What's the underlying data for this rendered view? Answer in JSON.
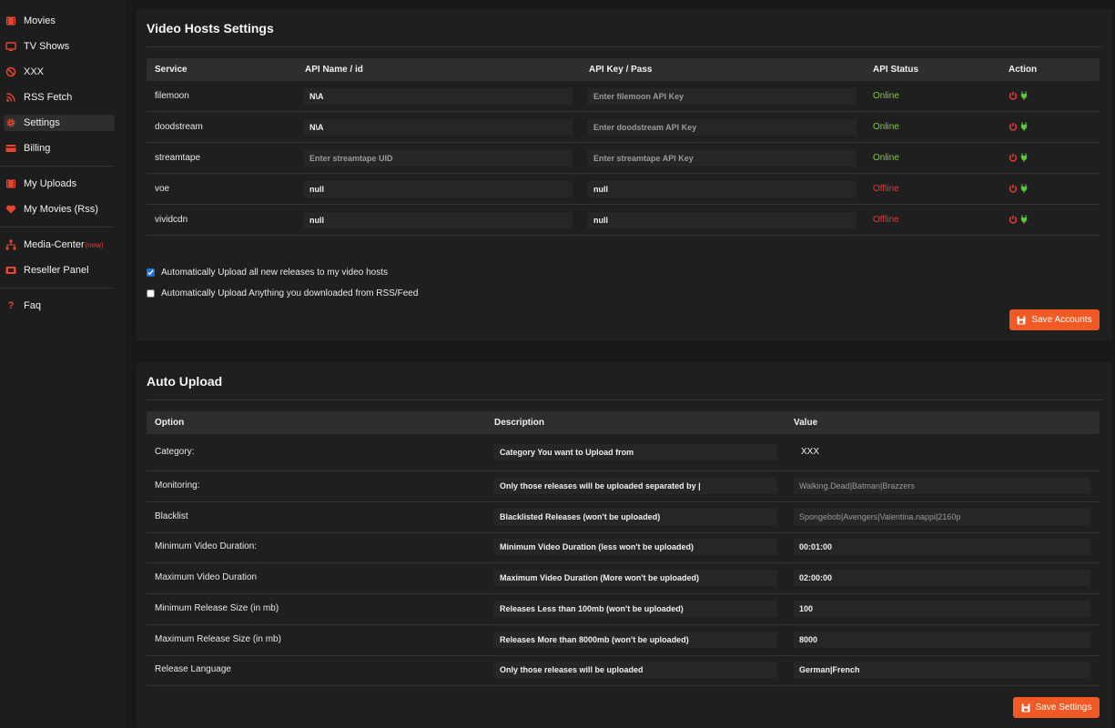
{
  "sidebar": {
    "items": [
      {
        "label": "Movies",
        "icon": "film-icon"
      },
      {
        "label": "TV Shows",
        "icon": "tv-icon"
      },
      {
        "label": "XXX",
        "icon": "ban-icon"
      },
      {
        "label": "RSS Fetch",
        "icon": "rss-icon"
      },
      {
        "label": "Settings",
        "icon": "gear-icon"
      },
      {
        "label": "Billing",
        "icon": "card-icon"
      },
      {
        "label": "My Uploads",
        "icon": "film-icon"
      },
      {
        "label": "My Movies (Rss)",
        "icon": "heart-icon"
      },
      {
        "label": "Media-Center",
        "badge": "(new)",
        "icon": "network-icon"
      },
      {
        "label": "Reseller Panel",
        "icon": "video-icon"
      },
      {
        "label": "Faq",
        "icon": "question-icon"
      }
    ]
  },
  "hosts": {
    "title": "Video Hosts Settings",
    "headers": {
      "service": "Service",
      "api_name": "API Name / id",
      "api_key": "API Key / Pass",
      "api_status": "API Status",
      "action": "Action"
    },
    "rows": [
      {
        "service": "filemoon",
        "api_name": "N\\A",
        "api_name_placeholder": "",
        "api_key": "",
        "api_key_placeholder": "Enter filemoon API Key",
        "status": "Online"
      },
      {
        "service": "doodstream",
        "api_name": "N\\A",
        "api_name_placeholder": "",
        "api_key": "",
        "api_key_placeholder": "Enter doodstream API Key",
        "status": "Online"
      },
      {
        "service": "streamtape",
        "api_name": "",
        "api_name_placeholder": "Enter streamtape UID",
        "api_key": "",
        "api_key_placeholder": "Enter streamtape API Key",
        "status": "Online"
      },
      {
        "service": "voe",
        "api_name": "null",
        "api_name_placeholder": "",
        "api_key": "null",
        "api_key_placeholder": "",
        "status": "Offline"
      },
      {
        "service": "vividcdn",
        "api_name": "null",
        "api_name_placeholder": "",
        "api_key": "null",
        "api_key_placeholder": "",
        "status": "Offline"
      }
    ],
    "auto_upload_new_label": "Automatically Upload all new releases to my video hosts",
    "auto_upload_new_checked": true,
    "auto_upload_rss_label": "Automatically Upload Anything you downloaded from RSS/Feed",
    "auto_upload_rss_checked": false,
    "save_label": "Save Accounts"
  },
  "auto_upload": {
    "title": "Auto Upload",
    "headers": {
      "option": "Option",
      "description": "Description",
      "value": "Value"
    },
    "rows": [
      {
        "option": "Category:",
        "description": "Category You want to Upload from",
        "value": "XXX",
        "value_type": "plain"
      },
      {
        "option": "Monitoring:",
        "description": "Only those releases will be uploaded separated by |",
        "value": "",
        "placeholder": "Walking.Dead|Batman|Brazzers",
        "value_type": "input"
      },
      {
        "option": "Blacklist",
        "description": "Blacklisted Releases (won't be uploaded)",
        "value": "",
        "placeholder": "Spongebob|Avengers|Valentina.nappi|2160p",
        "value_type": "input"
      },
      {
        "option": "Minimum Video Duration:",
        "description": "Minimum Video Duration (less won't be uploaded)",
        "value": "00:01:00",
        "value_type": "input"
      },
      {
        "option": "Maximum Video Duration",
        "description": "Maximum Video Duration (More won't be uploaded)",
        "value": "02:00:00",
        "value_type": "input"
      },
      {
        "option": "Minimum Release Size (in mb)",
        "description": "Releases Less than 100mb (won't be uploaded)",
        "value": "100",
        "value_type": "input"
      },
      {
        "option": "Maximum Release Size (in mb)",
        "description": "Releases More than 8000mb (won't be uploaded)",
        "value": "8000",
        "value_type": "input"
      },
      {
        "option": "Release Language",
        "description": "Only those releases will be uploaded",
        "value": "German|French",
        "value_type": "input"
      }
    ],
    "save_label": "Save Settings"
  },
  "colors": {
    "accent": "#f15a24",
    "online": "#7cd12a",
    "offline": "#e53935",
    "sidebar_icon": "#e8452c"
  }
}
